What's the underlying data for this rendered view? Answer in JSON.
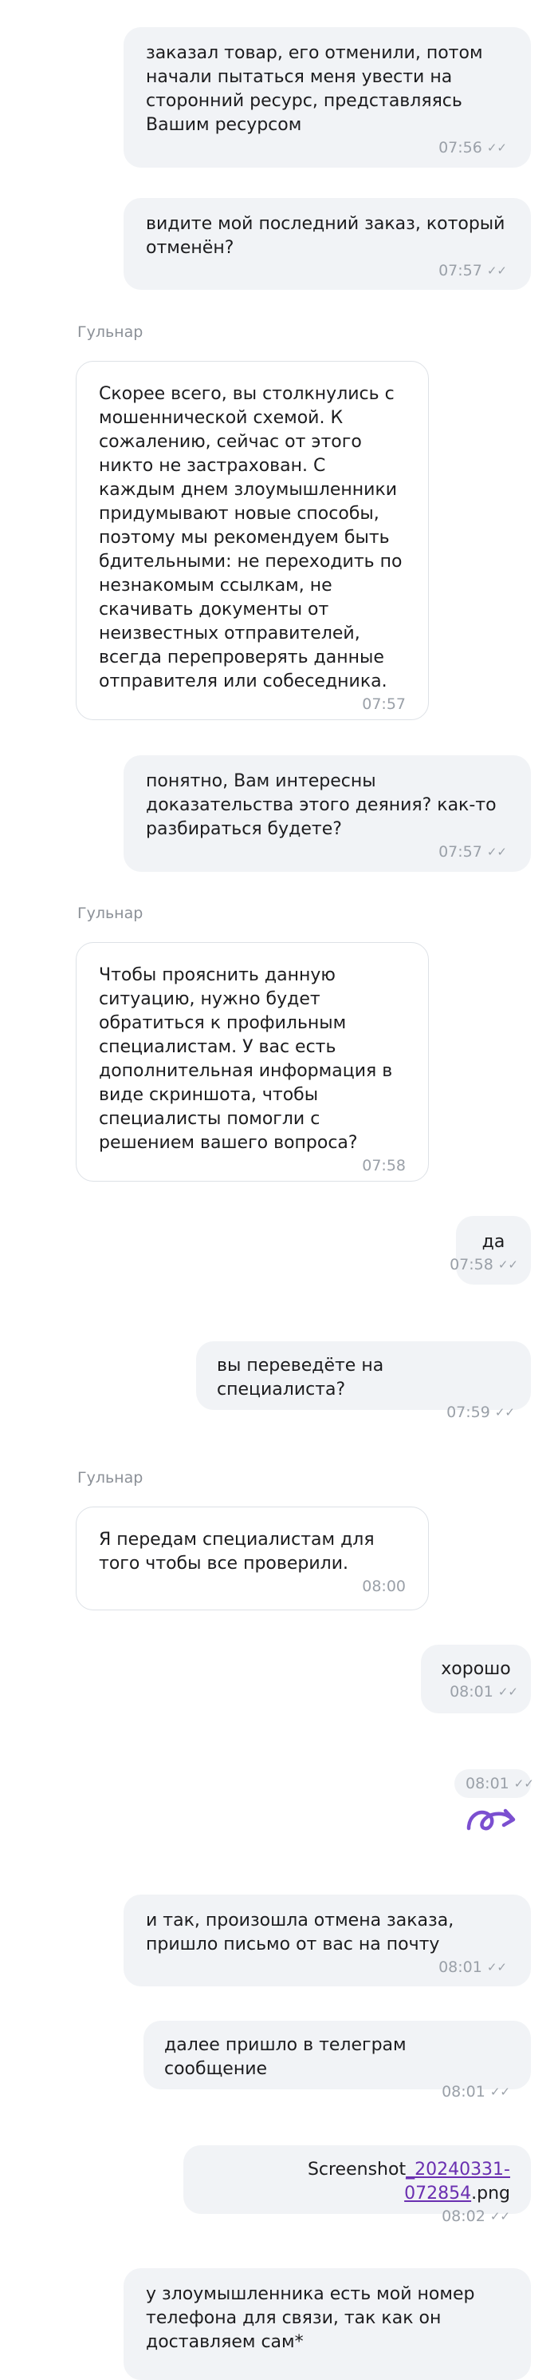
{
  "agent_name": "Гульнар",
  "messages": [
    {
      "text": "заказал товар, его отменили, потом начали пытаться меня увести на сторонний ресурс, представляясь Вашим ресурсом",
      "time": "07:56"
    },
    {
      "text": "видите мой последний заказ, который отменён?",
      "time": "07:57"
    },
    {
      "text": "Скорее всего, вы столкнулись с мошеннической схемой. К сожалению, сейчас от этого никто не застрахован. С каждым днем злоумышленники придумывают новые способы, поэтому мы рекомендуем быть бдительными: не переходить по незнакомым ссылкам, не скачивать документы от неизвестных отправителей, всегда перепроверять данные отправителя или собеседника.",
      "time": "07:57"
    },
    {
      "text": "понятно, Вам интересны доказательства этого деяния? как-то разбираться будете?",
      "time": "07:57"
    },
    {
      "text": "Чтобы прояснить данную ситуацию, нужно будет обратиться к профильным специалистам. У вас есть дополнительная информация в виде скриншота, чтобы специалисты помогли с решением вашего вопроса?",
      "time": "07:58"
    },
    {
      "text": "да",
      "time": "07:58"
    },
    {
      "text": "вы переведёте на специалиста?",
      "time": "07:59"
    },
    {
      "text": "Я передам специалистам для того чтобы  все проверили.",
      "time": "08:00"
    },
    {
      "text": "хорошо",
      "time": "08:01"
    },
    {
      "text": "",
      "time": "08:01"
    },
    {
      "text": "и так, произошла отмена заказа, пришло письмо от вас на почту",
      "time": "08:01"
    },
    {
      "text": "далее пришло в телеграм сообщение",
      "time": "08:01"
    },
    {
      "prefix": "Screenshot",
      "link": "_20240331-072854",
      "suffix": ".png",
      "time": "08:02"
    },
    {
      "text": "у злоумышленника есть мой номер телефона для связи, так как он доставляем сам*",
      "time": ""
    }
  ],
  "icons": {
    "read_check": "double-check-icon",
    "sticker": "purple-arrow-sticker"
  },
  "colors": {
    "outgoing_bg": "#f1f3f6",
    "incoming_border": "#dde1e6",
    "link": "#6a2fb0",
    "sticker": "#7b4fd0"
  }
}
